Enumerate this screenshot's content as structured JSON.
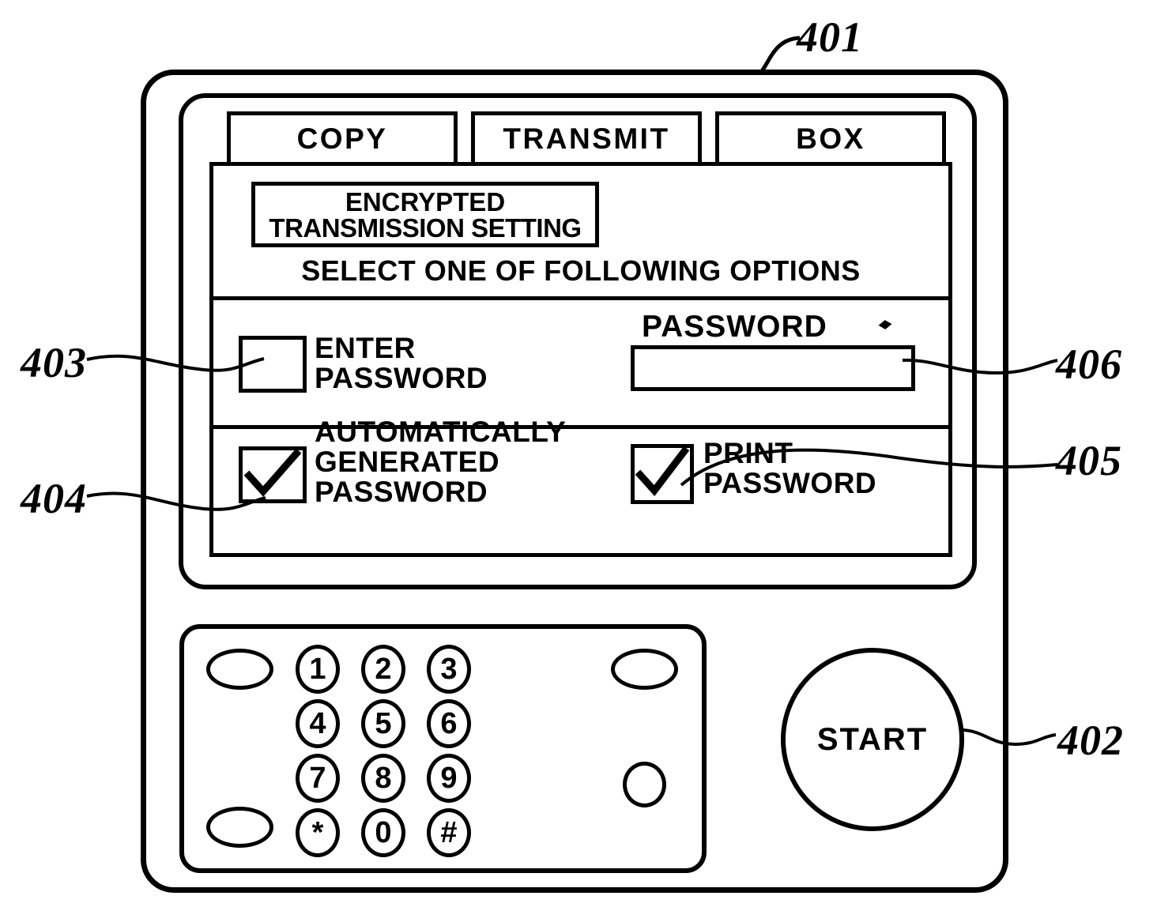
{
  "figure": {
    "refs": [
      {
        "id": "401",
        "label": "401",
        "target": "operation-panel-device"
      },
      {
        "id": "402",
        "label": "402",
        "target": "start-button"
      },
      {
        "id": "403",
        "label": "403",
        "target": "enter-password-checkbox"
      },
      {
        "id": "404",
        "label": "404",
        "target": "automatically-generated-password-checkbox"
      },
      {
        "id": "405",
        "label": "405",
        "target": "print-password-checkbox"
      },
      {
        "id": "406",
        "label": "406",
        "target": "password-input"
      }
    ]
  },
  "screen": {
    "tabs": [
      {
        "label": "COPY",
        "name": "tab-copy",
        "selected": false
      },
      {
        "label": "TRANSMIT",
        "name": "tab-transmit",
        "selected": true
      },
      {
        "label": "BOX",
        "name": "tab-box",
        "selected": false
      }
    ],
    "title": {
      "line1": "ENCRYPTED",
      "line2": "TRANSMISSION SETTING"
    },
    "instruction": "SELECT ONE OF FOLLOWING OPTIONS",
    "options": [
      {
        "name": "enter-password",
        "label_line1": "ENTER",
        "label_line2": "PASSWORD",
        "checked": false,
        "checkmark": ""
      },
      {
        "name": "automatically-generated-password",
        "label_line1": "AUTOMATICALLY",
        "label_line2": "GENERATED",
        "label_line3": "PASSWORD",
        "checked": true,
        "checkmark": "✓"
      },
      {
        "name": "print-password",
        "label_line1": "PRINT",
        "label_line2": "PASSWORD",
        "checked": true,
        "checkmark": "✓"
      }
    ],
    "password_field": {
      "label": "PASSWORD",
      "value": "",
      "placeholder": ""
    }
  },
  "keypad": {
    "keys": [
      {
        "label": "1",
        "name": "key-1"
      },
      {
        "label": "2",
        "name": "key-2"
      },
      {
        "label": "3",
        "name": "key-3"
      },
      {
        "label": "4",
        "name": "key-4"
      },
      {
        "label": "5",
        "name": "key-5"
      },
      {
        "label": "6",
        "name": "key-6"
      },
      {
        "label": "7",
        "name": "key-7"
      },
      {
        "label": "8",
        "name": "key-8"
      },
      {
        "label": "9",
        "name": "key-9"
      },
      {
        "label": "*",
        "name": "key-star"
      },
      {
        "label": "0",
        "name": "key-0"
      },
      {
        "label": "#",
        "name": "key-hash"
      }
    ],
    "function_keys": [
      {
        "label": "",
        "name": "function-key-top-left"
      },
      {
        "label": "",
        "name": "function-key-bottom-left"
      },
      {
        "label": "",
        "name": "function-key-top-right"
      },
      {
        "label": "",
        "name": "function-key-bottom-right"
      }
    ]
  },
  "start_button": {
    "label": "START"
  },
  "colors": {
    "ink": "#000000",
    "background": "#ffffff"
  }
}
